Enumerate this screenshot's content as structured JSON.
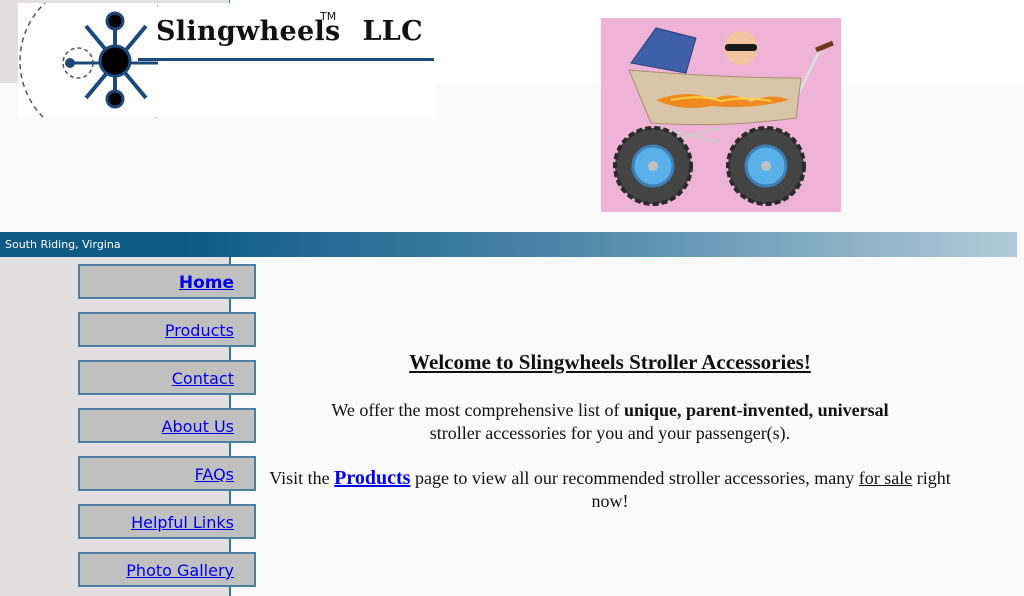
{
  "header": {
    "logo_text": "Slingwheels",
    "logo_tm": "TM",
    "logo_suffix": "LLC",
    "photo_alt": "Baby in stroller with monster truck wheels"
  },
  "banner": {
    "location": "South Riding, Virgina"
  },
  "sidebar": {
    "items": [
      {
        "label": "Home",
        "active": true
      },
      {
        "label": "Products",
        "active": false
      },
      {
        "label": "Contact",
        "active": false
      },
      {
        "label": "About Us",
        "active": false
      },
      {
        "label": "FAQs",
        "active": false
      },
      {
        "label": "Helpful Links",
        "active": false
      },
      {
        "label": "Photo Gallery",
        "active": false
      }
    ]
  },
  "main": {
    "welcome": "Welcome to Slingwheels Stroller Accessories!",
    "para1_prefix": "We offer the most comprehensive list of ",
    "para1_bold": "unique, parent-invented, universal",
    "para1_suffix": " stroller accessories for you and your passenger(s).",
    "para2_prefix": "Visit the ",
    "para2_link": "Products",
    "para2_middle": " page to view all our recommended stroller accessories, many ",
    "para2_sale": "for sale",
    "para2_suffix": " right now!"
  },
  "colors": {
    "banner_dark": "#0e5a85",
    "banner_light": "#b2cad8",
    "nav_button_bg": "#c0c0c0",
    "nav_border": "#4a7fa3",
    "link": "#0000ee",
    "sidebar_bg": "#e1dfe0",
    "photo_bg": "#f0b3d8"
  }
}
